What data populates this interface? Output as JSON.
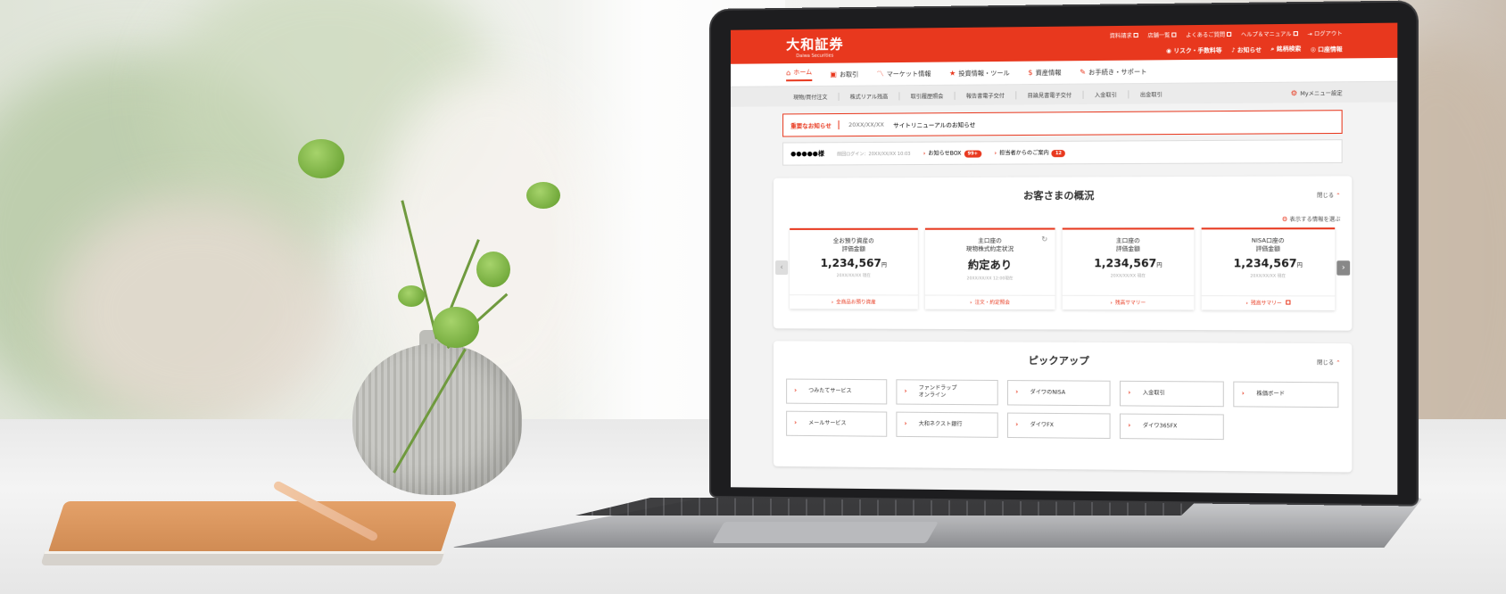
{
  "site": {
    "logo": "大和証券",
    "logo_sub": "Daiwa Securities"
  },
  "header": {
    "util_row1": [
      "資料請求",
      "店舗一覧",
      "よくあるご質問",
      "ヘルプ＆マニュアル",
      "ログアウト"
    ],
    "util_row2": [
      "リスク・手数料等",
      "お知らせ",
      "銘柄検索",
      "口座情報"
    ]
  },
  "main_nav": [
    "ホーム",
    "お取引",
    "マーケット情報",
    "投資情報・ツール",
    "資産情報",
    "お手続き・サポート"
  ],
  "sub_nav": {
    "items": [
      "現物/買付注文",
      "株式リアル残高",
      "取引履歴照会",
      "報告書電子交付",
      "目論見書電子交付",
      "入金取引",
      "出金取引"
    ],
    "mymenu": "Myメニュー設定"
  },
  "notice": {
    "label": "重要なお知らせ",
    "date": "20XX/XX/XX",
    "text": "サイトリニューアルのお知らせ"
  },
  "user": {
    "name": "●●●●●様",
    "last_login": "前回ログイン：20XX/XX/XX 10:03",
    "inbox_label": "お知らせBOX",
    "inbox_count": "99+",
    "guide_label": "担当者からのご案内",
    "guide_count": "12"
  },
  "summary": {
    "title": "お客さまの概況",
    "close_label": "閉じる",
    "select_label": "表示する情報を選ぶ",
    "cards": [
      {
        "label": "全お預り資産の\n評価金額",
        "value": "1,234,567",
        "unit": "円",
        "date": "20XX/XX/XX 現在",
        "link": "全商品お預り資産"
      },
      {
        "label": "主口座の\n現物株式約定状況",
        "value": "約定あり",
        "unit": "",
        "date": "20XX/XX/XX 12:00現在",
        "link": "注文・約定照会"
      },
      {
        "label": "主口座の\n評価金額",
        "value": "1,234,567",
        "unit": "円",
        "date": "20XX/XX/XX 現在",
        "link": "残高サマリー"
      },
      {
        "label": "NISA口座の\n評価金額",
        "value": "1,234,567",
        "unit": "円",
        "date": "20XX/XX/XX 現在",
        "link": "残高サマリー"
      }
    ]
  },
  "pickup": {
    "title": "ピックアップ",
    "close_label": "閉じる",
    "items": [
      "つみたてサービス",
      "ファンドラップ\nオンライン",
      "ダイワのNISA",
      "入金取引",
      "株価ボード",
      "メールサービス",
      "大和ネクスト銀行",
      "ダイワFX",
      "ダイワ365FX"
    ]
  },
  "colors": {
    "brand": "#e8381e"
  }
}
